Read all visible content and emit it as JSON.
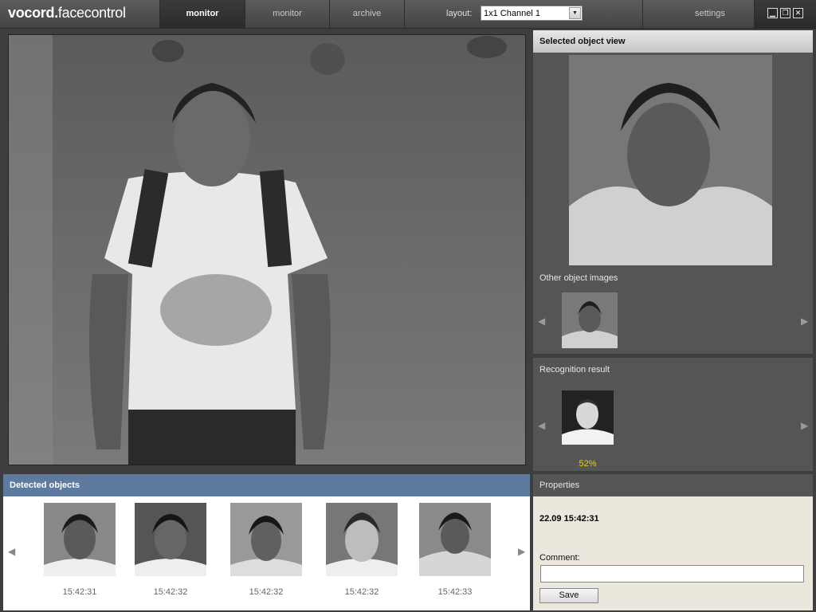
{
  "app": {
    "logo_bold": "vocord.",
    "logo_light": "facecontrol"
  },
  "tabs": [
    {
      "label": "monitor",
      "active": true
    },
    {
      "label": "monitor",
      "active": false
    },
    {
      "label": "archive",
      "active": false
    }
  ],
  "layout": {
    "label": "layout:",
    "selected": "1x1 Channel 1"
  },
  "settings_label": "settings",
  "window_controls": [
    "minimize-icon",
    "restore-icon",
    "close-icon"
  ],
  "selected_view": {
    "title": "Selected object view",
    "other_images_label": "Other object images"
  },
  "recognition": {
    "title": "Recognition result",
    "score": "52%"
  },
  "detected": {
    "title": "Detected objects",
    "items": [
      {
        "time": "15:42:31"
      },
      {
        "time": "15:42:32"
      },
      {
        "time": "15:42:32"
      },
      {
        "time": "15:42:32"
      },
      {
        "time": "15:42:33"
      }
    ]
  },
  "properties": {
    "title": "Properties",
    "datetime": "22.09  15:42:31",
    "comment_label": "Comment:",
    "comment_value": "",
    "save_label": "Save"
  },
  "colors": {
    "accent": "#5e7a9e",
    "score": "#f0d000",
    "panel": "#555555"
  }
}
